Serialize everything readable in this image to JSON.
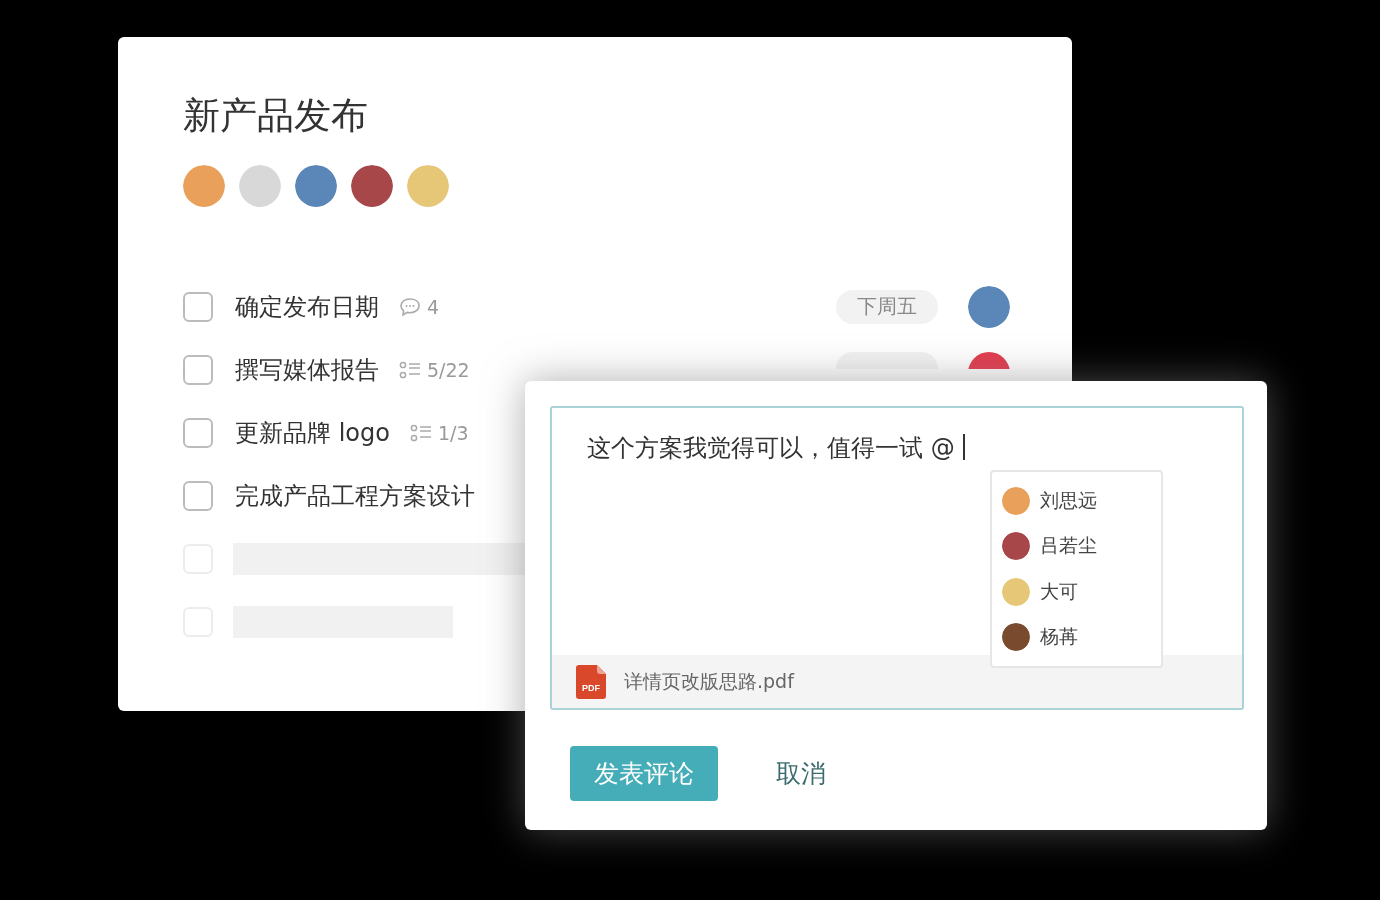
{
  "project": {
    "title": "新产品发布",
    "members": [
      {
        "color": "#e8a05a"
      },
      {
        "color": "#d8d8d8"
      },
      {
        "color": "#5b86b8"
      },
      {
        "color": "#a8474a"
      },
      {
        "color": "#e6c777"
      }
    ],
    "tasks": [
      {
        "kind": "task",
        "title": "确定发布日期",
        "checked": false,
        "meta": {
          "kind": "comments",
          "count": "4"
        },
        "due": "下周五",
        "covered": false,
        "assignee": {
          "color": "#5b86b8"
        }
      },
      {
        "kind": "task",
        "title": "撰写媒体报告",
        "checked": false,
        "meta": {
          "kind": "subtasks",
          "count": "5/22"
        },
        "covered": true,
        "assignee": {
          "color": "#e23b4e"
        }
      },
      {
        "kind": "task",
        "title": "更新品牌 logo",
        "checked": false,
        "meta": {
          "kind": "subtasks",
          "count": "1/3"
        }
      },
      {
        "kind": "task",
        "title": "完成产品工程方案设计",
        "checked": false
      },
      {
        "kind": "skeleton"
      },
      {
        "kind": "skeleton"
      }
    ]
  },
  "comment": {
    "value": "这个方案我觉得可以，值得一试 @",
    "mentions": [
      {
        "name": "刘思远",
        "color": "#e8a05a"
      },
      {
        "name": "吕若尘",
        "color": "#a8474a"
      },
      {
        "name": "大可",
        "color": "#e6c777"
      },
      {
        "name": "杨苒",
        "color": "#7a4a2e"
      }
    ],
    "attachment": {
      "file_type": "PDF",
      "name": "详情页改版思路.pdf"
    },
    "buttons": [
      {
        "kind": "primary",
        "label": "发表评论"
      },
      {
        "kind": "text",
        "label": "取消"
      }
    ]
  }
}
